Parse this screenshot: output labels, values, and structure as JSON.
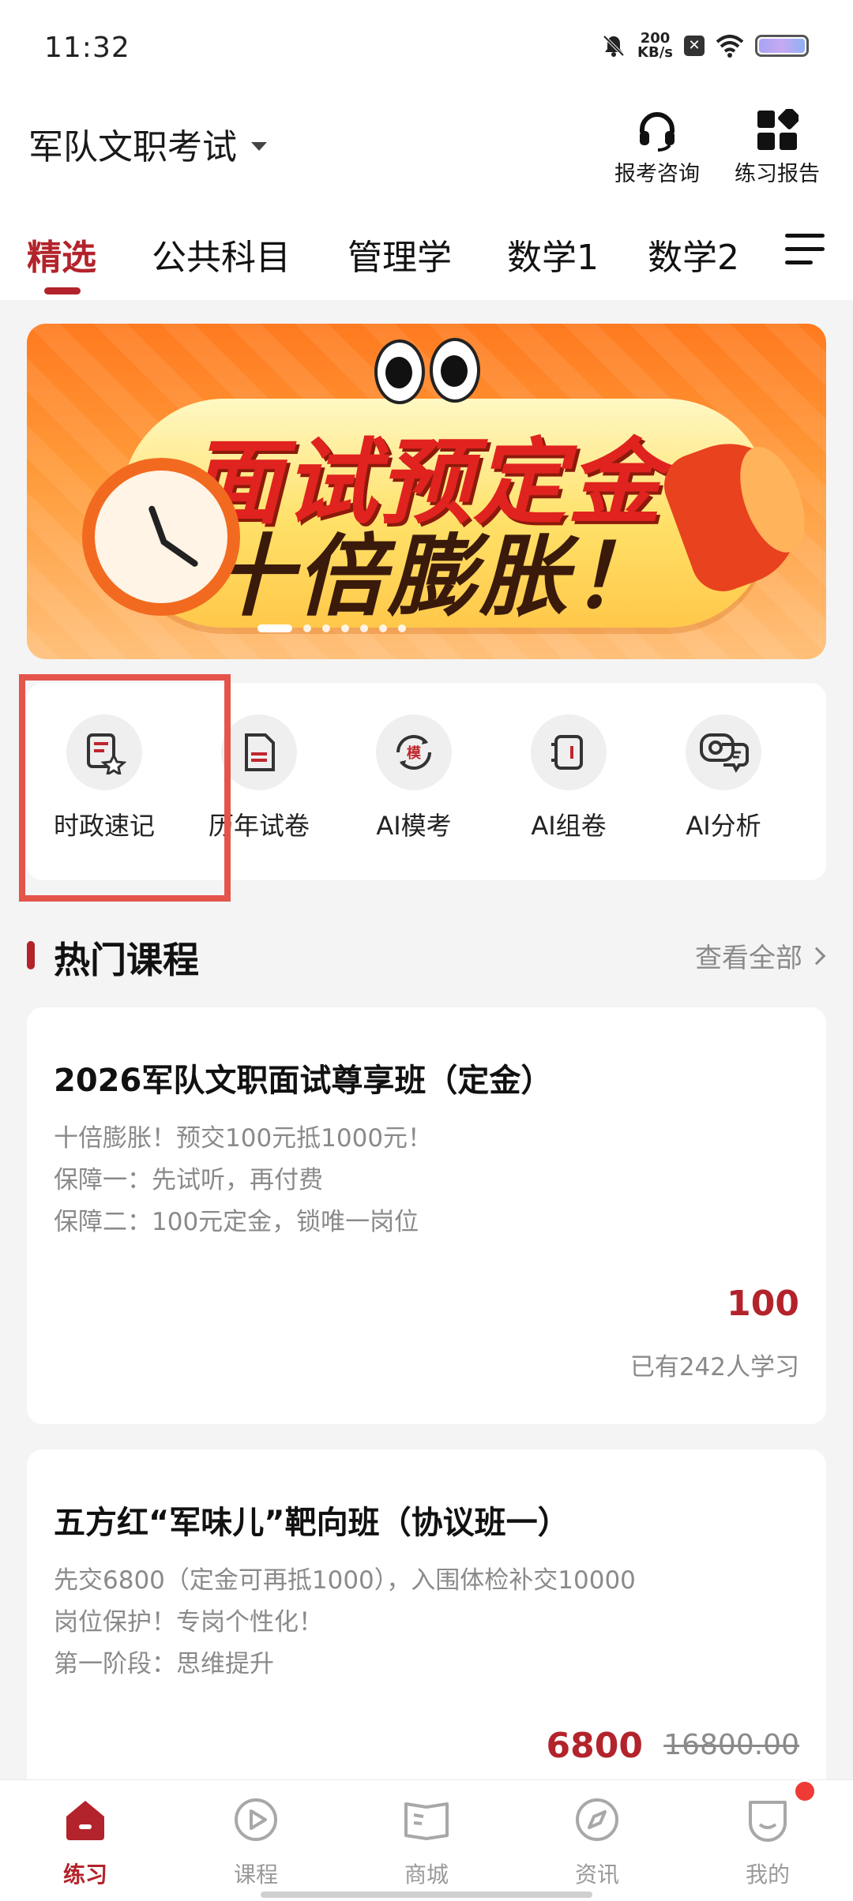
{
  "status_bar": {
    "time": "11:32",
    "net_speed_value": "200",
    "net_speed_unit": "KB/s"
  },
  "header": {
    "title": "军队文职考试",
    "actions": [
      {
        "label": "报考咨询",
        "icon": "headset-icon"
      },
      {
        "label": "练习报告",
        "icon": "grid-report-icon"
      }
    ]
  },
  "tabs": [
    {
      "label": "精选",
      "active": true
    },
    {
      "label": "公共科目",
      "active": false
    },
    {
      "label": "管理学",
      "active": false
    },
    {
      "label": "数学1",
      "active": false
    },
    {
      "label": "数学2",
      "active": false
    }
  ],
  "banner": {
    "line1": "面试预定金",
    "line2": "十倍膨胀！",
    "slide_count": 7,
    "active_slide": 0
  },
  "quick_access": [
    {
      "label": "时政速记",
      "icon": "notes-star-icon"
    },
    {
      "label": "历年试卷",
      "icon": "paper-icon"
    },
    {
      "label": "AI模考",
      "icon": "mock-exam-icon"
    },
    {
      "label": "AI组卷",
      "icon": "compose-paper-icon"
    },
    {
      "label": "AI分析",
      "icon": "analysis-icon"
    }
  ],
  "hot_courses": {
    "title": "热门课程",
    "view_all": "查看全部",
    "courses": [
      {
        "title": "2026军队文职面试尊享班（定金）",
        "desc": [
          "十倍膨胀！预交100元抵1000元！",
          "保障一：先试听，再付费",
          "保障二：100元定金，锁唯一岗位"
        ],
        "price": "100",
        "learners": "已有242人学习"
      },
      {
        "title": "五方红“军味儿”靶向班（协议班一）",
        "desc": [
          "先交6800（定金可再抵1000），入围体检补交10000",
          "岗位保护！专岗个性化！",
          "第一阶段：思维提升"
        ],
        "price": "6800",
        "original_price": "16800.00"
      }
    ]
  },
  "bottom_nav": [
    {
      "label": "练习",
      "icon": "home-icon",
      "active": true
    },
    {
      "label": "课程",
      "icon": "play-icon",
      "active": false
    },
    {
      "label": "商城",
      "icon": "book-icon",
      "active": false
    },
    {
      "label": "资讯",
      "icon": "compass-icon",
      "active": false
    },
    {
      "label": "我的",
      "icon": "smile-icon",
      "active": false
    }
  ],
  "colors": {
    "accent": "#b3232b",
    "highlight": "#e5544b",
    "badge": "#ee3b36"
  }
}
